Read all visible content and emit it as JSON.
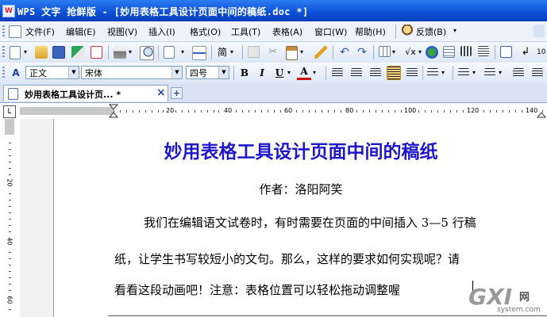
{
  "titlebar": {
    "title": "WPS 文字 抢鲜版 - [妙用表格工具设计页面中间的稿纸.doc *]"
  },
  "menubar": {
    "items": [
      "文件(F)",
      "编辑(E)",
      "视图(V)",
      "插入(I)",
      "格式(O)",
      "工具(T)",
      "表格(A)",
      "窗口(W)",
      "帮助(H)",
      "反馈(B)"
    ]
  },
  "toolbar": {
    "jian_label": "简",
    "font_color_label": "A"
  },
  "format_bar": {
    "style_value": "正文",
    "font_value": "宋体",
    "size_value": "四号",
    "bold_label": "B",
    "italic_label": "I",
    "underline_label": "U",
    "fontcolor_label": "A"
  },
  "tabs": {
    "doc_tab": "妙用表格工具设计页... *",
    "close_label": "×",
    "new_label": "+"
  },
  "ruler": {
    "horizontal_labels": [
      "20",
      "40",
      "60",
      "80",
      "100",
      "120",
      "140"
    ],
    "vertical_labels": [
      "20",
      "40",
      "60"
    ],
    "corner_label": "L"
  },
  "document": {
    "title": "妙用表格工具设计页面中间的稿纸",
    "author": "作者：洛阳阿笑",
    "lines": [
      "我们在编辑语文试卷时，有时需要在页面的中间插入 3—5 行稿",
      "纸，让学生书写较短小的文句。那么，这样的要求如何实现呢？请",
      "看看这段动画吧！注意：表格位置可以轻松拖动调整喔"
    ]
  },
  "watermark": {
    "main": "GXI",
    "cn": "网",
    "sub": "system.com"
  },
  "colors": {
    "title_blue": "#1d17c9",
    "titlebar": "#0a4fd6"
  }
}
